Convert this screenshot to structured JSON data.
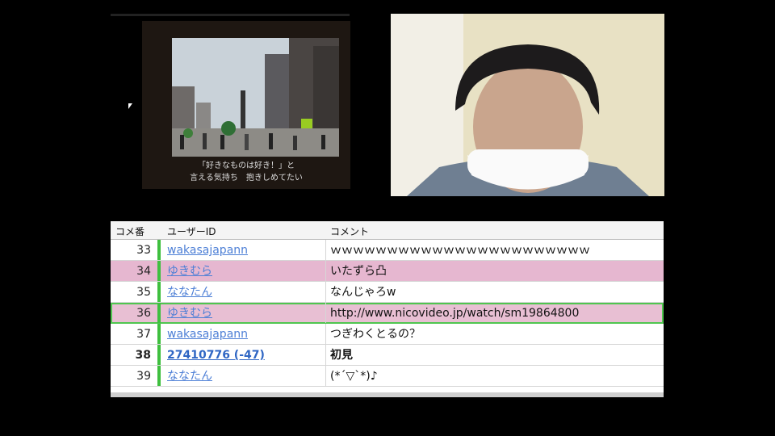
{
  "slide": {
    "caption_line1": "「好きなものは好き！」と",
    "caption_line2": "言える気持ち　抱きしめてたい"
  },
  "grid": {
    "headers": {
      "number": "コメ番",
      "user": "ユーザーID",
      "comment": "コメント"
    },
    "rows": [
      {
        "number": "33",
        "user": "wakasajapann",
        "comment": "ｗｗｗｗｗｗｗｗｗｗｗｗｗｗｗｗｗｗｗｗｗｗｗ",
        "style": "plain"
      },
      {
        "number": "34",
        "user": "ゆきむら",
        "comment": "いたずら凸",
        "style": "pink"
      },
      {
        "number": "35",
        "user": "ななたん",
        "comment": "なんじゃろw",
        "style": "plain"
      },
      {
        "number": "36",
        "user": "ゆきむら",
        "comment": "http://www.nicovideo.jp/watch/sm19864800",
        "style": "selected"
      },
      {
        "number": "37",
        "user": "wakasajapann",
        "comment": "つぎわくとるの？",
        "style": "plain"
      },
      {
        "number": "38",
        "user": "27410776 (-47)",
        "comment": "初見",
        "style": "bold"
      },
      {
        "number": "39",
        "user": "ななたん",
        "comment": "(*´▽`*)♪",
        "style": "plain"
      }
    ]
  },
  "colors": {
    "pink_row": "#e6b7d0",
    "selection_border": "#4fc64f",
    "user_link": "#4d7fd6",
    "user_bar": "#3fbf3f"
  }
}
